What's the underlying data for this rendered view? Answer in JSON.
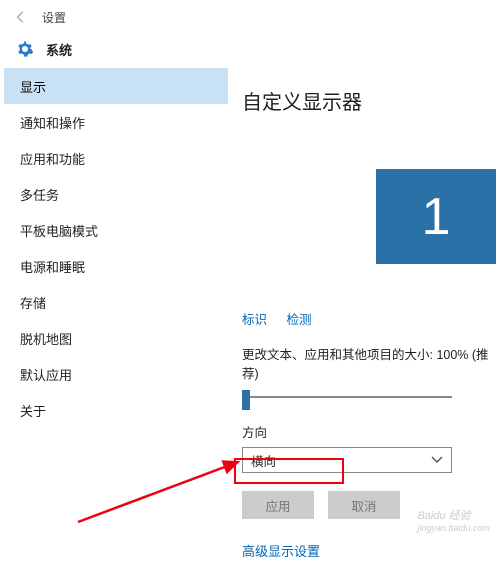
{
  "titlebar": {
    "label": "设置"
  },
  "header": {
    "title": "系统"
  },
  "sidebar": {
    "items": [
      {
        "label": "显示",
        "active": true
      },
      {
        "label": "通知和操作"
      },
      {
        "label": "应用和功能"
      },
      {
        "label": "多任务"
      },
      {
        "label": "平板电脑模式"
      },
      {
        "label": "电源和睡眠"
      },
      {
        "label": "存储"
      },
      {
        "label": "脱机地图"
      },
      {
        "label": "默认应用"
      },
      {
        "label": "关于"
      }
    ]
  },
  "main": {
    "page_title": "自定义显示器",
    "monitor_number": "1",
    "links": {
      "identify": "标识",
      "detect": "检测"
    },
    "scale_label": "更改文本、应用和其他项目的大小: 100% (推荐)",
    "orientation_label": "方向",
    "orientation_value": "横向",
    "apply_btn": "应用",
    "cancel_btn": "取消",
    "advanced_link": "高级显示设置"
  },
  "watermark": {
    "brand": "Baidu 经验",
    "url": "jingyan.baidu.com"
  }
}
